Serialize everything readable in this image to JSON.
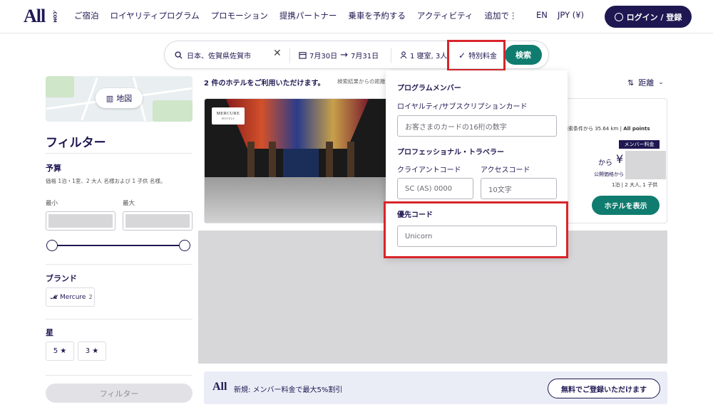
{
  "header": {
    "logo": "All",
    "logo_suffix": ".COM",
    "nav": [
      "ご宿泊",
      "ロイヤリティプログラム",
      "プロモーション",
      "提携パートナー",
      "乗車を予約する",
      "アクティビティ",
      "追加で⋮"
    ],
    "lang": "EN",
    "currency": "JPY (¥)",
    "login": "ログイン / 登録"
  },
  "search": {
    "destination": "日本、佐賀県佐賀市",
    "clear": "✕",
    "checkin": "7月30日",
    "checkout": "7月31日",
    "rooms": "1 寝室, 3人",
    "special_rates": "特別料金",
    "search_button": "検索"
  },
  "sidebar": {
    "map_button": "地図",
    "filter_title": "フィルター",
    "budget_title": "予算",
    "budget_note": "価格 1泊・1室、2 大人 名様および 1 子供 名様。",
    "min_label": "最小",
    "max_label": "最大",
    "brand_title": "ブランド",
    "brand_name": "Mercure",
    "brand_count": "2",
    "stars_title": "星",
    "star_options": [
      "5 ★",
      "3 ★"
    ],
    "filter_button": "フィルター"
  },
  "results": {
    "count": "2 件のホテルをご利用いただけます。",
    "note": "検索結果からの距離",
    "sort_label": "距離",
    "hotel": {
      "brand_badge": "MERCURE",
      "brand_badge_sub": "HOTELS",
      "distance": "検索条件から 35.64 km",
      "points_label": "All points",
      "member_badge": "メンバー料金",
      "from": "から",
      "yen": "¥",
      "public_price": "公開価格から",
      "occupancy": "1泊 | 2 大人, 1 子供",
      "show_button": "ホテルを表示"
    }
  },
  "promo": {
    "logo": "All",
    "text": "新規: メンバー料金で最大5%割引",
    "button": "無料でご登録いただけます"
  },
  "dropdown": {
    "program_member_title": "プログラムメンバー",
    "loyalty_card_label": "ロイヤルティ/サブスクリプションカード",
    "loyalty_card_placeholder": "お客さまのカードの16桁の数字",
    "professional_title": "プロフェッショナル・トラベラー",
    "client_code_label": "クライアントコード",
    "access_code_label": "アクセスコード",
    "client_code_placeholder": "SC (AS) 0000",
    "access_code_placeholder": "10文字",
    "priority_code_title": "優先コード",
    "priority_code_value": "Unicorn"
  },
  "colors": {
    "brand_navy": "#1e1852",
    "accent_teal": "#0f7c6f",
    "highlight_red": "#d9252a"
  }
}
